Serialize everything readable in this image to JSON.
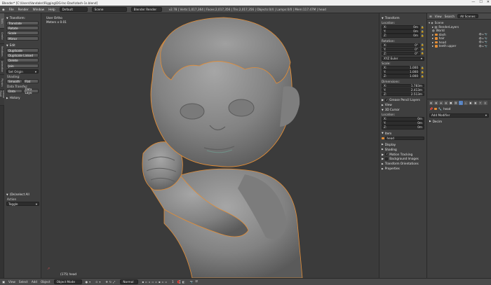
{
  "titlebar": {
    "title": "Blender* [C:\\Users\\Vandaler\\Rigging\\DG-Inc-Dash\\dash-1s.blend]",
    "minimize": "—",
    "maximize": "☐",
    "close": "✕"
  },
  "menubar": {
    "menus": [
      "File",
      "Render",
      "Window",
      "Help"
    ],
    "layout": "Default",
    "scene": "Scene",
    "engine": "Blender Render",
    "stats": "v2.78 | Verts:1,017,364 | Faces:2,017,356 | Tris:2,017,356 | Objects:0/4 | Lamps:0/0 | Mem:117.47M | head"
  },
  "tabs": [
    "Tools",
    "Create",
    "Relations",
    "Animation",
    "Physics",
    "Grease Pencil"
  ],
  "toolshelf": {
    "transform": {
      "title": "Transform:",
      "buttons": [
        "Translate",
        "Rotate",
        "Scale"
      ],
      "mirror": "Mirror"
    },
    "edit": {
      "title": "Edit",
      "buttons": [
        "Duplicate",
        "Duplicate Linked",
        "Delete",
        "Join"
      ],
      "set_origin": "Set Origin",
      "shading_label": "Shading:",
      "smooth": "Smooth",
      "flat": "Flat",
      "data_transfer_label": "Data Transfer:",
      "data": "Data",
      "data_layout": "Data Layo"
    },
    "history": {
      "title": "History"
    },
    "operator": {
      "title": "(De)select All",
      "action_label": "Action",
      "action_value": "Toggle"
    }
  },
  "viewport": {
    "view_label": "User Ortho",
    "scale_label": "Meters x 0.01",
    "object_label": "(175) head"
  },
  "npanel": {
    "transform_title": "Transform",
    "location_label": "Location:",
    "location": [
      {
        "axis": "X:",
        "value": "0m"
      },
      {
        "axis": "Y:",
        "value": "0m"
      },
      {
        "axis": "Z:",
        "value": "0m"
      }
    ],
    "rotation_label": "Rotation:",
    "rotation": [
      {
        "axis": "X:",
        "value": "0°"
      },
      {
        "axis": "Y:",
        "value": "0°"
      },
      {
        "axis": "Z:",
        "value": "0°"
      }
    ],
    "rotation_mode": "XYZ Euler",
    "scale_label": "Scale:",
    "scale": [
      {
        "axis": "X:",
        "value": "1.000"
      },
      {
        "axis": "Y:",
        "value": "1.000"
      },
      {
        "axis": "Z:",
        "value": "1.000"
      }
    ],
    "dimensions_label": "Dimensions:",
    "dimensions": [
      {
        "axis": "X:",
        "value": "1.783m"
      },
      {
        "axis": "Y:",
        "value": "2.413m"
      },
      {
        "axis": "Z:",
        "value": "2.513m"
      }
    ],
    "grease_pencil": "Grease Pencil Layers",
    "view_title": "View",
    "cursor_title": "3D Cursor",
    "cursor_location_label": "Location:",
    "cursor_location": [
      {
        "axis": "X:",
        "value": "0m"
      },
      {
        "axis": "Y:",
        "value": "0m"
      },
      {
        "axis": "Z:",
        "value": "0m"
      }
    ],
    "item_title": "Item",
    "item_name": "head",
    "display_title": "Display",
    "shading_title": "Shading",
    "motion_tracking": "Motion Tracking",
    "background_images": "Background Images",
    "transform_orientations": "Transform Orientations",
    "properties_title": "Properties"
  },
  "outliner": {
    "view": "View",
    "search": "Search",
    "all_scenes": "All Scenes",
    "items": [
      {
        "name": "Scene",
        "indent": 0,
        "icon": "scene-icon"
      },
      {
        "name": "RenderLayers",
        "indent": 1,
        "icon": "render-layers-icon"
      },
      {
        "name": "World",
        "indent": 1,
        "icon": "world-icon"
      },
      {
        "name": "dash",
        "indent": 1,
        "icon": "object-icon"
      },
      {
        "name": "hair",
        "indent": 1,
        "icon": "object-icon"
      },
      {
        "name": "head",
        "indent": 1,
        "icon": "object-icon"
      },
      {
        "name": "teeth upper",
        "indent": 1,
        "icon": "object-icon"
      }
    ]
  },
  "properties": {
    "object_name": "head",
    "add_modifier": "Add Modifier",
    "decim_title": "Decim"
  },
  "bottombar": {
    "menus": [
      "View",
      "Select",
      "Add",
      "Object"
    ],
    "mode": "Object Mode",
    "pivot": "Normal",
    "layer": "1"
  },
  "colors": {
    "selection_outline": "#e48e36",
    "active_tab": "#5680c2"
  }
}
